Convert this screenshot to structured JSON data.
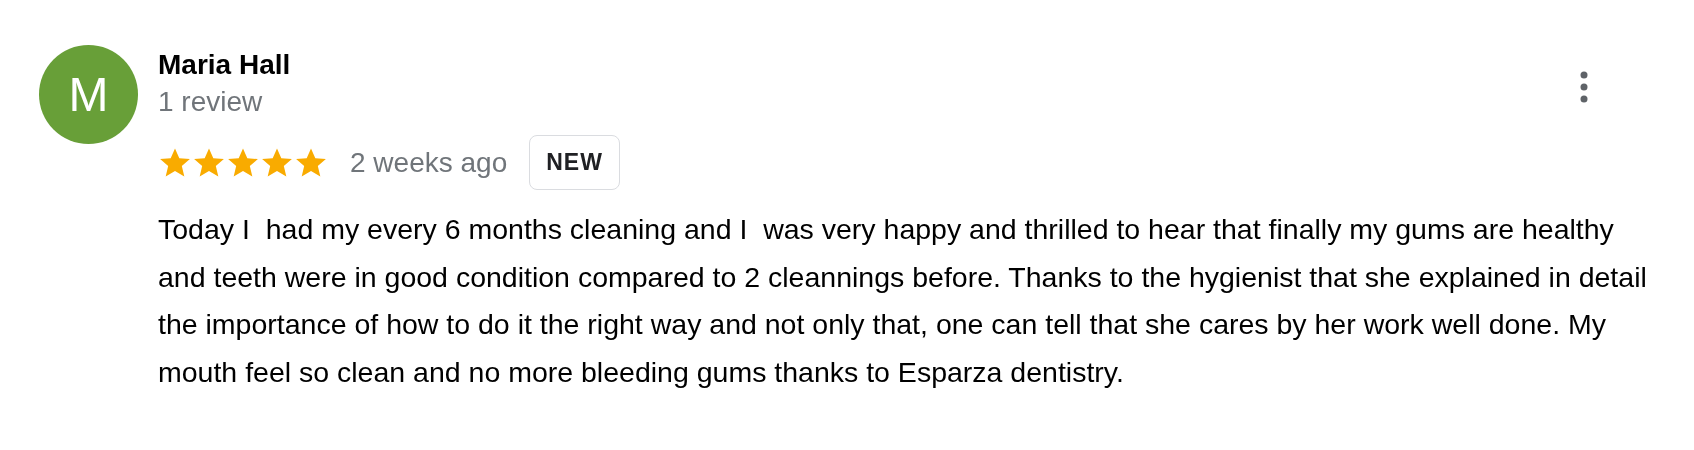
{
  "reviewer": {
    "initial": "M",
    "name": "Maria Hall",
    "review_count": "1 review"
  },
  "rating": {
    "stars": 5
  },
  "time": "2 weeks ago",
  "badge": "NEW",
  "body": "Today I  had my every 6 months cleaning and I  was very happy and thrilled to hear that finally my gums are healthy and teeth were in good condition compared to 2 cleannings before. Thanks to the hygienist that she explained in detail the importance of how to do it the right way and not only that, one can tell that she cares by her work well done. My mouth feel so clean and no more bleeding gums thanks to Esparza dentistry."
}
